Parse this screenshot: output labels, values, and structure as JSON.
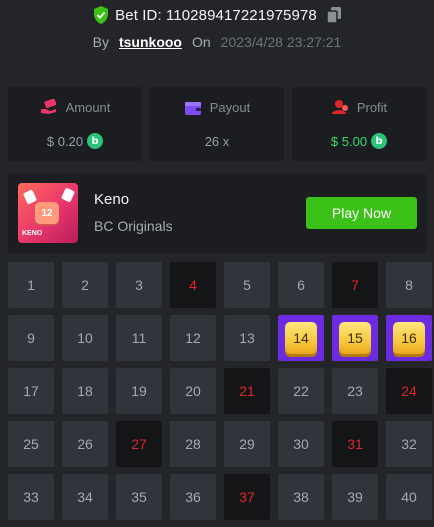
{
  "header": {
    "bet_id": "Bet ID: 110289417221975978",
    "by_label": "By",
    "username": "tsunkooo",
    "on_label": "On",
    "datetime": "2023/4/28 23:27:21"
  },
  "stats": {
    "amount": {
      "label": "Amount",
      "value": "$ 0.20",
      "icon": "money-hand-icon"
    },
    "payout": {
      "label": "Payout",
      "value": "26 x",
      "icon": "wallet-icon"
    },
    "profit": {
      "label": "Profit",
      "value": "$ 5.00",
      "icon": "profit-user-icon"
    },
    "coin_symbol": "b"
  },
  "game": {
    "name": "Keno",
    "provider": "BC Originals",
    "thumb_tile": "12",
    "thumb_label": "KENO",
    "play_label": "Play Now"
  },
  "colors": {
    "accent_green": "#3bc117",
    "profit_green": "#3ddc6b",
    "picked_red": "#e0262a",
    "hit_purple": "#6b2be0",
    "gem_gold": "#f8c93c"
  },
  "board": {
    "cells": [
      {
        "n": "1",
        "state": "normal"
      },
      {
        "n": "2",
        "state": "normal"
      },
      {
        "n": "3",
        "state": "normal"
      },
      {
        "n": "4",
        "state": "picked"
      },
      {
        "n": "5",
        "state": "normal"
      },
      {
        "n": "6",
        "state": "normal"
      },
      {
        "n": "7",
        "state": "picked"
      },
      {
        "n": "8",
        "state": "normal"
      },
      {
        "n": "9",
        "state": "normal"
      },
      {
        "n": "10",
        "state": "normal"
      },
      {
        "n": "11",
        "state": "normal"
      },
      {
        "n": "12",
        "state": "normal"
      },
      {
        "n": "13",
        "state": "normal"
      },
      {
        "n": "14",
        "state": "hit"
      },
      {
        "n": "15",
        "state": "hit"
      },
      {
        "n": "16",
        "state": "hit"
      },
      {
        "n": "17",
        "state": "normal"
      },
      {
        "n": "18",
        "state": "normal"
      },
      {
        "n": "19",
        "state": "normal"
      },
      {
        "n": "20",
        "state": "normal"
      },
      {
        "n": "21",
        "state": "picked"
      },
      {
        "n": "22",
        "state": "normal"
      },
      {
        "n": "23",
        "state": "normal"
      },
      {
        "n": "24",
        "state": "picked"
      },
      {
        "n": "25",
        "state": "normal"
      },
      {
        "n": "26",
        "state": "normal"
      },
      {
        "n": "27",
        "state": "picked"
      },
      {
        "n": "28",
        "state": "normal"
      },
      {
        "n": "29",
        "state": "normal"
      },
      {
        "n": "30",
        "state": "normal"
      },
      {
        "n": "31",
        "state": "picked"
      },
      {
        "n": "32",
        "state": "normal"
      },
      {
        "n": "33",
        "state": "normal"
      },
      {
        "n": "34",
        "state": "normal"
      },
      {
        "n": "35",
        "state": "normal"
      },
      {
        "n": "36",
        "state": "normal"
      },
      {
        "n": "37",
        "state": "picked"
      },
      {
        "n": "38",
        "state": "normal"
      },
      {
        "n": "39",
        "state": "normal"
      },
      {
        "n": "40",
        "state": "normal"
      }
    ]
  }
}
